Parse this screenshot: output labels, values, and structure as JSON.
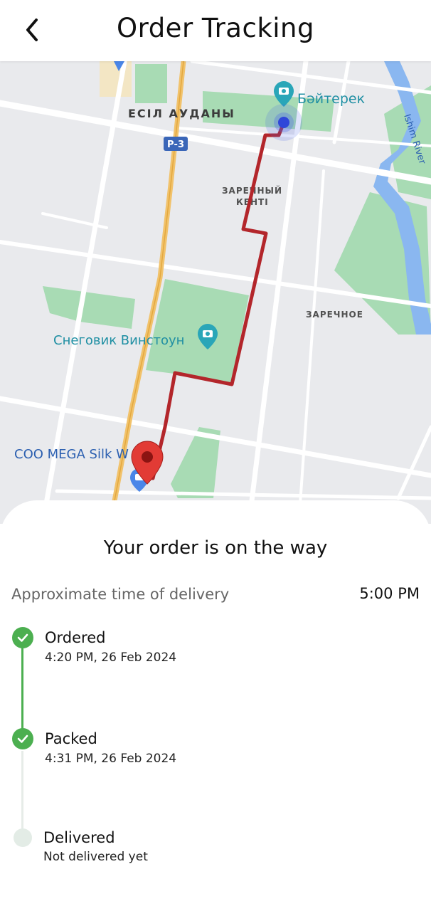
{
  "header": {
    "title": "Order Tracking",
    "back_icon": "chevron-left-icon"
  },
  "map": {
    "labels": {
      "district": "ЕСІЛ АУДАНЫ",
      "road": "Р-3",
      "baiterek": "Бәйтерек",
      "river": "Ishim River",
      "zarechny_line1": "ЗАРЕЧНЫЙ",
      "zarechny_line2": "КЕНТІ",
      "zarechnoe": "ЗАРЕЧНОЕ",
      "snowman": "Снеговик Винстоун",
      "mall": "COO MEGA Silk W"
    },
    "colors": {
      "route": "#b3262b",
      "park": "#a8dbb4",
      "water": "#8ab7f0",
      "highway": "#f1c26b",
      "poi": "#2aa6b8"
    }
  },
  "sheet": {
    "title": "Your order is on the way",
    "eta_label": "Approximate time of delivery",
    "eta_value": "5:00 PM"
  },
  "steps": [
    {
      "title": "Ordered",
      "subtitle": "4:20 PM, 26 Feb 2024",
      "status": "done"
    },
    {
      "title": "Packed",
      "subtitle": "4:31 PM, 26 Feb 2024",
      "status": "done"
    },
    {
      "title": "Delivered",
      "subtitle": "Not delivered yet",
      "status": "pending"
    }
  ],
  "colors": {
    "done": "#4caf50",
    "pending": "#e3ece6",
    "line_done": "#4caf50",
    "line_pending": "#e6ece8"
  }
}
